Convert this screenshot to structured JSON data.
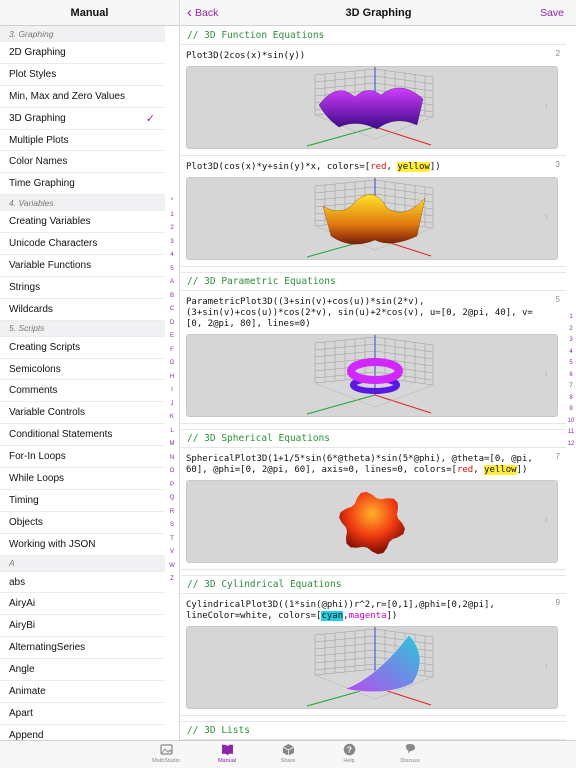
{
  "sidebar": {
    "title": "Manual",
    "rows": [
      {
        "kind": "section",
        "label": "3. Graphing"
      },
      {
        "kind": "item",
        "label": "2D Graphing"
      },
      {
        "kind": "item",
        "label": "Plot Styles"
      },
      {
        "kind": "item",
        "label": "Min, Max and Zero Values"
      },
      {
        "kind": "item",
        "label": "3D Graphing",
        "selected": true
      },
      {
        "kind": "item",
        "label": "Multiple Plots"
      },
      {
        "kind": "item",
        "label": "Color Names"
      },
      {
        "kind": "item",
        "label": "Time Graphing"
      },
      {
        "kind": "section",
        "label": "4. Variables"
      },
      {
        "kind": "item",
        "label": "Creating Variables"
      },
      {
        "kind": "item",
        "label": "Unicode Characters"
      },
      {
        "kind": "item",
        "label": "Variable Functions"
      },
      {
        "kind": "item",
        "label": "Strings"
      },
      {
        "kind": "item",
        "label": "Wildcards"
      },
      {
        "kind": "section",
        "label": "5. Scripts"
      },
      {
        "kind": "item",
        "label": "Creating Scripts"
      },
      {
        "kind": "item",
        "label": "Semicolons"
      },
      {
        "kind": "item",
        "label": "Comments"
      },
      {
        "kind": "item",
        "label": "Variable Controls"
      },
      {
        "kind": "item",
        "label": "Conditional Statements"
      },
      {
        "kind": "item",
        "label": "For-In Loops"
      },
      {
        "kind": "item",
        "label": "While Loops"
      },
      {
        "kind": "item",
        "label": "Timing"
      },
      {
        "kind": "item",
        "label": "Objects"
      },
      {
        "kind": "item",
        "label": "Working with JSON"
      },
      {
        "kind": "section",
        "label": "A"
      },
      {
        "kind": "item",
        "label": "abs"
      },
      {
        "kind": "item",
        "label": "AiryAi"
      },
      {
        "kind": "item",
        "label": "AiryBi"
      },
      {
        "kind": "item",
        "label": "AlternatingSeries"
      },
      {
        "kind": "item",
        "label": "Angle"
      },
      {
        "kind": "item",
        "label": "Animate"
      },
      {
        "kind": "item",
        "label": "Apart"
      },
      {
        "kind": "item",
        "label": "Append"
      }
    ],
    "check_mark": "✓",
    "index_letters": [
      "*",
      "1",
      "2",
      "3",
      "4",
      "5",
      "A",
      "B",
      "C",
      "D",
      "E",
      "F",
      "G",
      "H",
      "I",
      "J",
      "K",
      "L",
      "M",
      "N",
      "O",
      "P",
      "Q",
      "R",
      "S",
      "T",
      "V",
      "W",
      "Z"
    ]
  },
  "header": {
    "back_label": "Back",
    "title": "3D Graphing",
    "save_label": "Save"
  },
  "main": {
    "sections": [
      {
        "comment": "// 3D Function Equations",
        "entries": [
          {
            "num": "2",
            "plot": "surface1",
            "segments": [
              {
                "t": "Plot3D(2cos(x)*sin(y))"
              }
            ]
          },
          {
            "num": "3",
            "plot": "surface2",
            "segments": [
              {
                "t": "Plot3D(cos(x)*y+sin(y)*x, colors=["
              },
              {
                "t": "red",
                "c": "red"
              },
              {
                "t": ", "
              },
              {
                "t": "yellow",
                "c": "yellow"
              },
              {
                "t": "])"
              }
            ]
          }
        ]
      },
      {
        "comment": "// 3D Parametric Equations",
        "entries": [
          {
            "num": "5",
            "plot": "torus",
            "segments": [
              {
                "t": "ParametricPlot3D((3+sin(v)+cos(u))*sin(2*v), (3+sin(v)+cos(u))*cos(2*v), sin(u)+2*cos(v), u=[0, 2@pi, 40], v=[0, 2@pi, 80], lines=0)"
              }
            ]
          }
        ]
      },
      {
        "comment": "// 3D Spherical Equations",
        "entries": [
          {
            "num": "7",
            "plot": "sphere",
            "segments": [
              {
                "t": "SphericalPlot3D(1+1/5*sin(6*@theta)*sin(5*@phi), @theta=[0, @pi, 60], @phi=[0, 2@pi, 60], axis=0, lines=0, colors=["
              },
              {
                "t": "red",
                "c": "red"
              },
              {
                "t": ", "
              },
              {
                "t": "yellow",
                "c": "yellow"
              },
              {
                "t": "])"
              }
            ]
          }
        ]
      },
      {
        "comment": "// 3D Cylindrical Equations",
        "entries": [
          {
            "num": "9",
            "plot": "cylinder",
            "segments": [
              {
                "t": "CylindricalPlot3D((1*sin(@phi))r^2,r=[0,1],@phi=[0,2@pi], lineColor=white, colors=["
              },
              {
                "t": "cyan",
                "c": "cyan"
              },
              {
                "t": ","
              },
              {
                "t": "magenta",
                "c": "magenta"
              },
              {
                "t": "])"
              }
            ]
          }
        ]
      },
      {
        "comment": "// 3D Lists",
        "entries": []
      }
    ],
    "chevron": "›",
    "right_index": [
      "1",
      "2",
      "3",
      "4",
      "5",
      "6",
      "7",
      "8",
      "9",
      "10",
      "11",
      "12"
    ]
  },
  "tabbar": {
    "tabs": [
      {
        "label": "MathStudio",
        "icon": "image-icon",
        "active": false
      },
      {
        "label": "Manual",
        "icon": "book-icon",
        "active": true
      },
      {
        "label": "Share",
        "icon": "box-icon",
        "active": false
      },
      {
        "label": "Help",
        "icon": "help-icon",
        "active": false
      },
      {
        "label": "Discuss",
        "icon": "chat-icon",
        "active": false
      }
    ]
  },
  "colors": {
    "accent": "#8e24aa",
    "comment": "#2d8f3a",
    "plot_bg": "#d6d6d6"
  }
}
